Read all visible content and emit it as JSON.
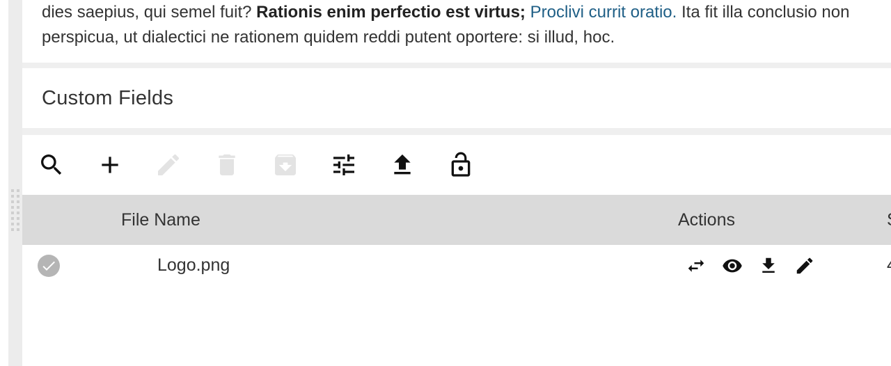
{
  "article": {
    "line1_start": "dies saepius, qui semel fuit? ",
    "line1_bold": "Rationis enim perfectio est virtus;",
    "line1_link": "Proclivi currit oratio.",
    "line1_end": " Ita fit illa conclusio non",
    "line2": "perspicua, ut dialectici ne rationem quidem reddi putent oportere: si illud, hoc."
  },
  "custom_fields": {
    "title": "Custom Fields"
  },
  "toolbar": {
    "buttons": [
      {
        "name": "search",
        "icon": "search-icon",
        "enabled": true
      },
      {
        "name": "add",
        "icon": "plus-icon",
        "enabled": true
      },
      {
        "name": "edit",
        "icon": "pencil-icon",
        "enabled": false
      },
      {
        "name": "delete",
        "icon": "trash-icon",
        "enabled": false
      },
      {
        "name": "archive",
        "icon": "archive-icon",
        "enabled": false
      },
      {
        "name": "settings",
        "icon": "sliders-icon",
        "enabled": true
      },
      {
        "name": "upload",
        "icon": "upload-icon",
        "enabled": true
      },
      {
        "name": "unlock",
        "icon": "unlock-icon",
        "enabled": true
      }
    ]
  },
  "grid": {
    "columns": {
      "file_name": "File Name",
      "actions": "Actions",
      "size_partial": "S"
    },
    "rows": [
      {
        "selected": true,
        "file_name": "Logo.png",
        "actions": [
          "swap-icon",
          "eye-icon",
          "download-icon",
          "pencil-icon"
        ],
        "size_partial": "4"
      }
    ]
  },
  "colors": {
    "link": "#1f5f86",
    "header_bg": "#dadada",
    "disabled_icon": "#e3e3e3",
    "check_bg": "#b5b5b5"
  }
}
